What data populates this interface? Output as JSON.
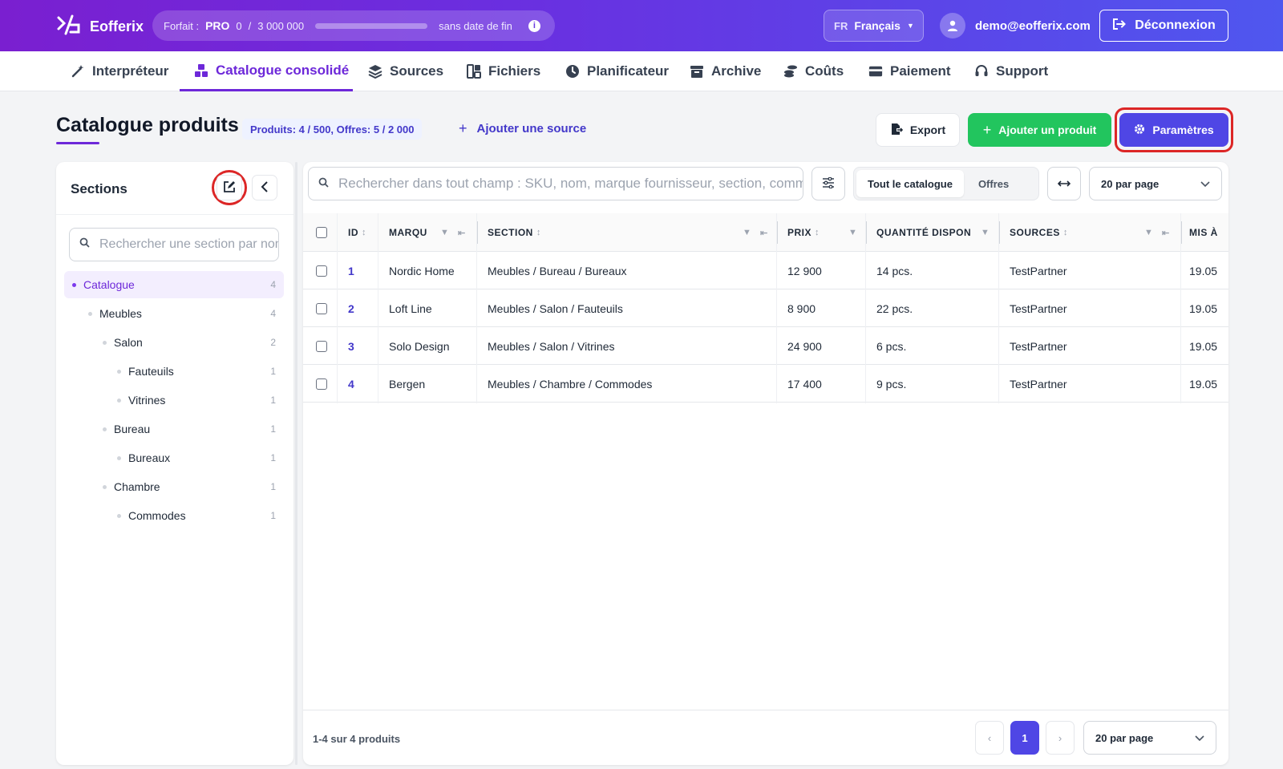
{
  "topbar": {
    "brand": "Eofferix",
    "plan_label": "Forfait :",
    "plan_name": "PRO",
    "usage_current": "0",
    "usage_separator": "/",
    "usage_total": "3 000 000",
    "usage_fraction": 0,
    "plan_period": "sans date de fin",
    "language_code": "FR",
    "language_name": "Français",
    "user_email": "demo@eofferix.com",
    "logout_label": "Déconnexion"
  },
  "nav": {
    "items": [
      {
        "label": "Interpréteur",
        "icon": "wand-icon"
      },
      {
        "label": "Catalogue consolidé",
        "icon": "boxes-icon",
        "active": true
      },
      {
        "label": "Sources",
        "icon": "layers-icon"
      },
      {
        "label": "Fichiers",
        "icon": "grid-icon"
      },
      {
        "label": "Planificateur",
        "icon": "clock-icon"
      },
      {
        "label": "Archive",
        "icon": "archive-icon"
      },
      {
        "label": "Coûts",
        "icon": "coins-icon"
      },
      {
        "label": "Paiement",
        "icon": "card-icon"
      },
      {
        "label": "Support",
        "icon": "headset-icon"
      }
    ]
  },
  "page": {
    "title": "Catalogue produits",
    "counts": "Produits: 4 / 500, Offres: 5 / 2 000",
    "add_source": "Ajouter une source",
    "export_label": "Export",
    "add_product_label": "Ajouter un produit",
    "params_label": "Paramètres"
  },
  "sections": {
    "title": "Sections",
    "search_placeholder": "Rechercher une section par nom",
    "tree": [
      {
        "label": "Catalogue",
        "count": "4",
        "level": 0,
        "selected": true
      },
      {
        "label": "Meubles",
        "count": "4",
        "level": 1
      },
      {
        "label": "Salon",
        "count": "2",
        "level": 2
      },
      {
        "label": "Fauteuils",
        "count": "1",
        "level": 3
      },
      {
        "label": "Vitrines",
        "count": "1",
        "level": 3
      },
      {
        "label": "Bureau",
        "count": "1",
        "level": 2
      },
      {
        "label": "Bureaux",
        "count": "1",
        "level": 3
      },
      {
        "label": "Chambre",
        "count": "1",
        "level": 2
      },
      {
        "label": "Commodes",
        "count": "1",
        "level": 3
      }
    ]
  },
  "toolbar": {
    "search_placeholder": "Rechercher dans tout champ : SKU, nom, marque fournisseur, section, commentaire",
    "view_all": "Tout le catalogue",
    "view_offers": "Offres",
    "per_page": "20 par page"
  },
  "table": {
    "headers": {
      "id": "ID",
      "brand": "MARQU",
      "section": "SECTION",
      "price": "PRIX",
      "qty": "QUANTITÉ DISPON",
      "sources": "SOURCES",
      "updated": "MIS À"
    },
    "rows": [
      {
        "id": "1",
        "brand": "Nordic Home",
        "section": "Meubles / Bureau / Bureaux",
        "price": "12 900",
        "qty": "14 pcs.",
        "sources": "TestPartner",
        "updated": "19.05"
      },
      {
        "id": "2",
        "brand": "Loft Line",
        "section": "Meubles / Salon / Fauteuils",
        "price": "8 900",
        "qty": "22 pcs.",
        "sources": "TestPartner",
        "updated": "19.05"
      },
      {
        "id": "3",
        "brand": "Solo Design",
        "section": "Meubles / Salon / Vitrines",
        "price": "24 900",
        "qty": "6 pcs.",
        "sources": "TestPartner",
        "updated": "19.05"
      },
      {
        "id": "4",
        "brand": "Bergen",
        "section": "Meubles / Chambre / Commodes",
        "price": "17 400",
        "qty": "9 pcs.",
        "sources": "TestPartner",
        "updated": "19.05"
      }
    ]
  },
  "footer": {
    "summary": "1-4 sur 4 produits",
    "prev": "‹",
    "page": "1",
    "next": "›",
    "per_page": "20 par page"
  },
  "colors": {
    "accent": "#4f46e5",
    "active_nav": "#6d28d9",
    "success": "#22c55e",
    "highlight_ring": "#dc2626"
  }
}
